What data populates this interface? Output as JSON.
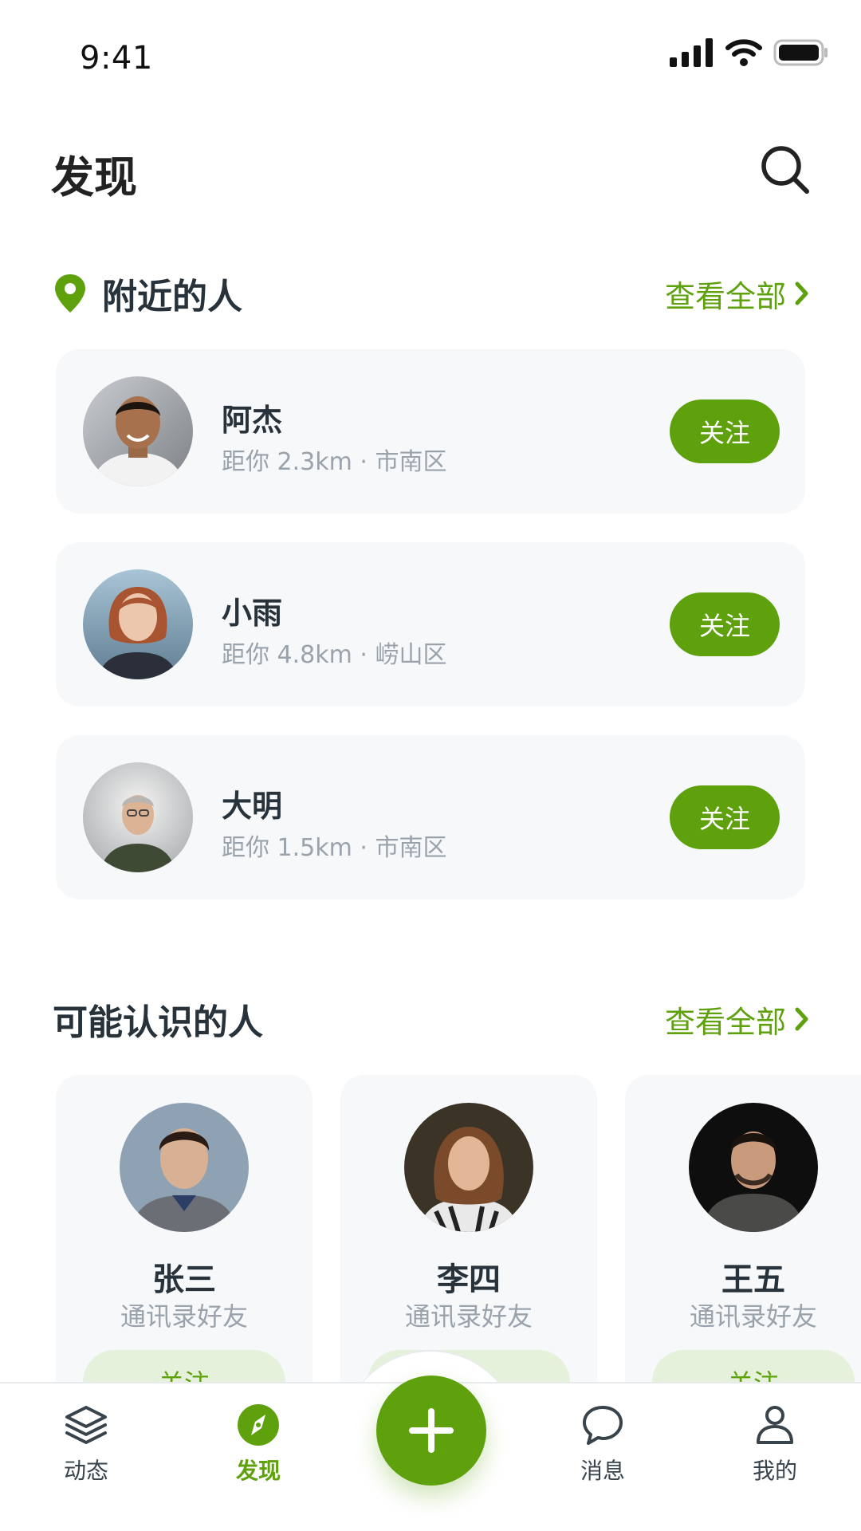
{
  "status_bar": {
    "time": "9:41"
  },
  "header": {
    "title": "发现"
  },
  "nearby": {
    "title": "附近的人",
    "see_all": "查看全部",
    "people": [
      {
        "name": "阿杰",
        "meta": "距你 2.3km · 市南区",
        "follow_label": "关注"
      },
      {
        "name": "小雨",
        "meta": "距你 4.8km · 崂山区",
        "follow_label": "关注"
      },
      {
        "name": "大明",
        "meta": "距你 1.5km · 市南区",
        "follow_label": "关注"
      }
    ]
  },
  "suggested": {
    "title": "可能认识的人",
    "see_all": "查看全部",
    "people": [
      {
        "name": "张三",
        "subtitle": "通讯录好友",
        "follow_label": "关注"
      },
      {
        "name": "李四",
        "subtitle": "通讯录好友",
        "follow_label": "关注"
      },
      {
        "name": "王五",
        "subtitle": "通讯录好友",
        "follow_label": "关注"
      }
    ]
  },
  "tab_bar": {
    "items": [
      {
        "label": "动态",
        "icon": "layers-icon"
      },
      {
        "label": "发现",
        "icon": "compass-icon"
      },
      {
        "label": "消息",
        "icon": "chat-bubble-icon"
      },
      {
        "label": "我的",
        "icon": "user-icon"
      }
    ],
    "active": "发现",
    "fab_icon": "plus-icon"
  },
  "colors": {
    "accent": "#5ea10d",
    "accent_light": "#e6f1dc",
    "card_bg": "#f6f8fa",
    "text_primary": "#27323a",
    "text_secondary": "#9aa3ab"
  }
}
